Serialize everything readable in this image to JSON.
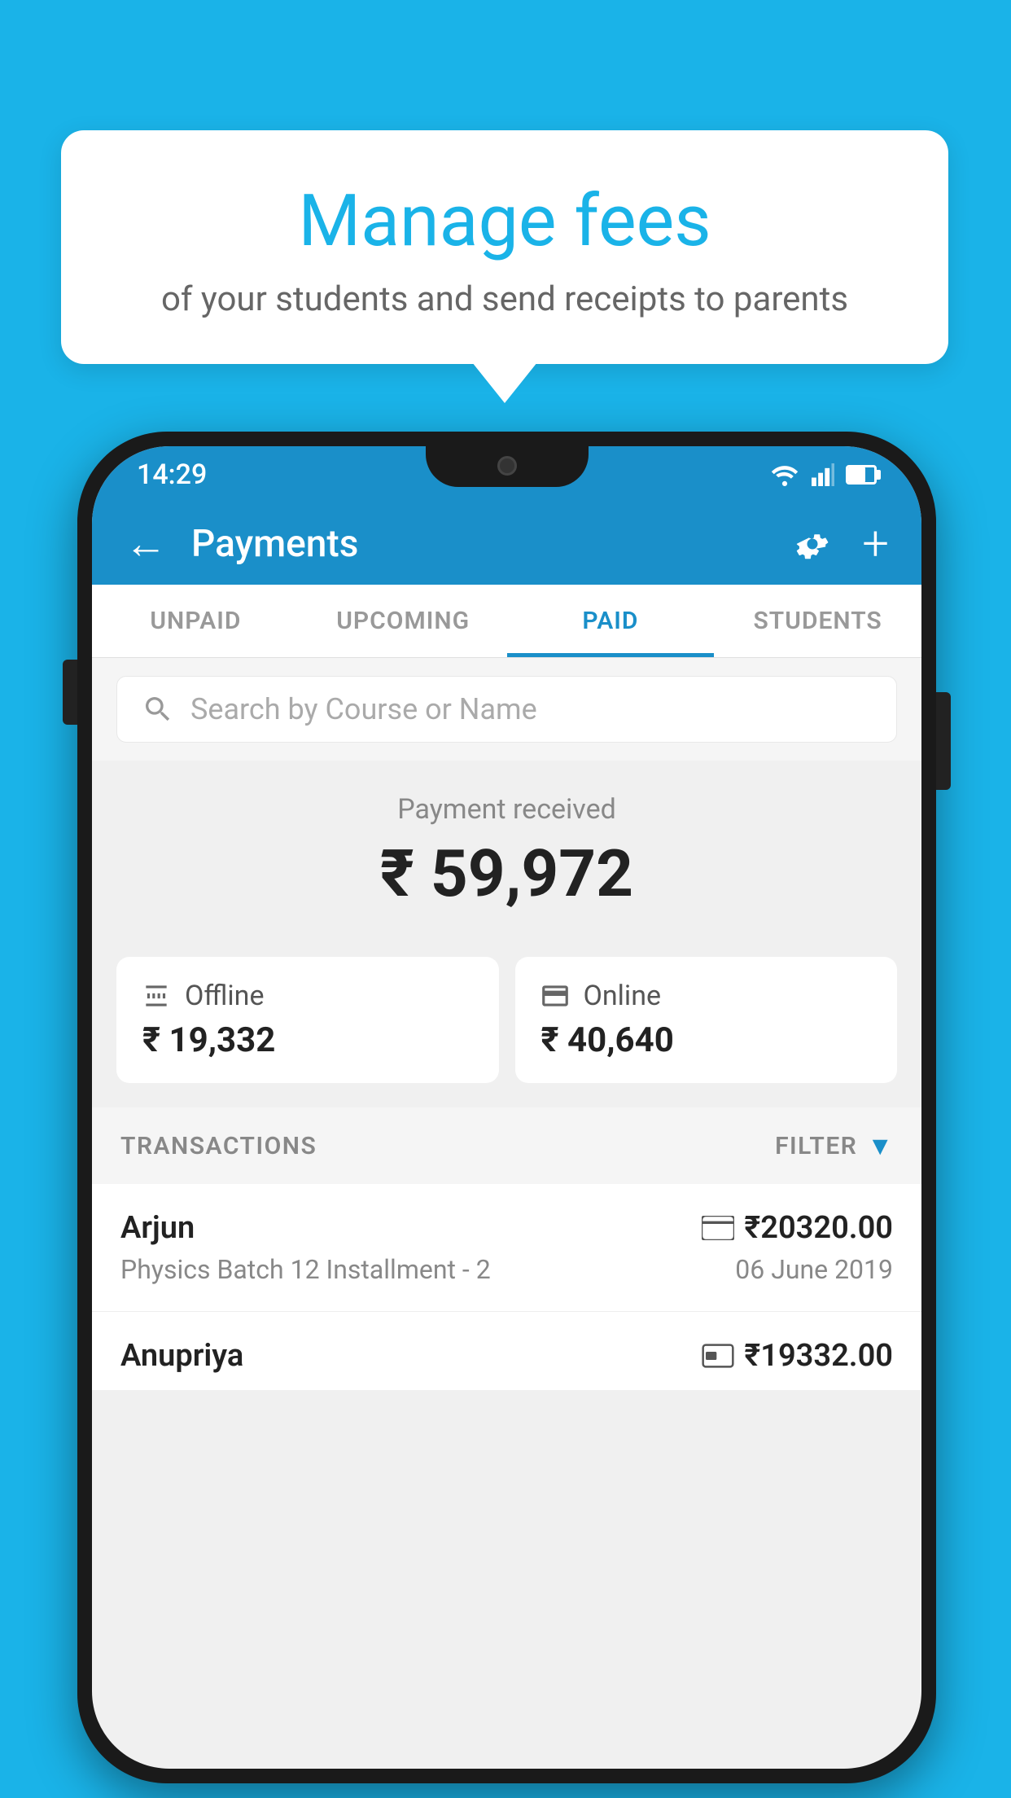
{
  "background_color": "#1ab3e8",
  "bubble": {
    "title": "Manage fees",
    "subtitle": "of your students and send receipts to parents"
  },
  "status_bar": {
    "time": "14:29"
  },
  "app_bar": {
    "title": "Payments",
    "back_label": "←",
    "plus_label": "+"
  },
  "tabs": [
    {
      "label": "UNPAID",
      "active": false
    },
    {
      "label": "UPCOMING",
      "active": false
    },
    {
      "label": "PAID",
      "active": true
    },
    {
      "label": "STUDENTS",
      "active": false
    }
  ],
  "search": {
    "placeholder": "Search by Course or Name"
  },
  "payment_summary": {
    "label": "Payment received",
    "amount": "₹ 59,972",
    "offline": {
      "type": "Offline",
      "amount": "₹ 19,332"
    },
    "online": {
      "type": "Online",
      "amount": "₹ 40,640"
    }
  },
  "transactions": {
    "header_label": "TRANSACTIONS",
    "filter_label": "FILTER",
    "rows": [
      {
        "name": "Arjun",
        "course": "Physics Batch 12 Installment - 2",
        "amount": "₹20320.00",
        "date": "06 June 2019",
        "method": "online"
      },
      {
        "name": "Anupriya",
        "course": "",
        "amount": "₹19332.00",
        "date": "",
        "method": "offline"
      }
    ]
  }
}
